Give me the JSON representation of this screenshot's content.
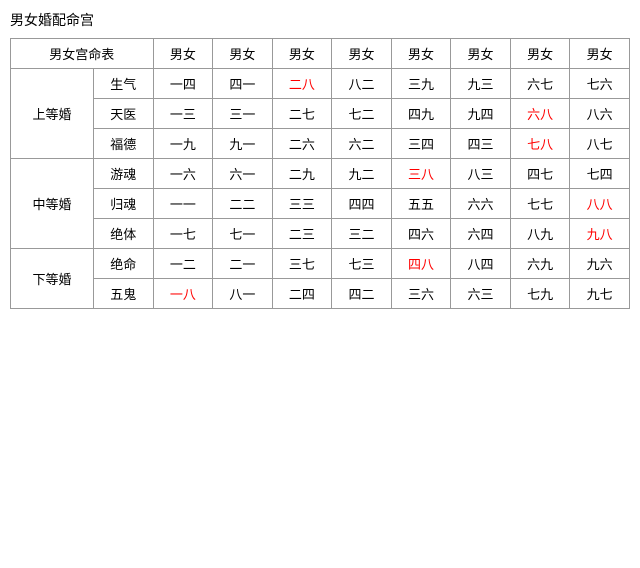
{
  "title": "男女婚配命宫",
  "table": {
    "header": {
      "col0": "男女宫命表",
      "cols": [
        "男女",
        "男女",
        "男女",
        "男女",
        "男女",
        "男女",
        "男女",
        "男女"
      ]
    },
    "groups": [
      {
        "group_label": "上等婚",
        "rows": [
          {
            "sub_label": "生气",
            "cells": [
              {
                "text": "一四",
                "red": false
              },
              {
                "text": "四一",
                "red": false
              },
              {
                "text": "二八",
                "red": true
              },
              {
                "text": "八二",
                "red": false
              },
              {
                "text": "三九",
                "red": false
              },
              {
                "text": "九三",
                "red": false
              },
              {
                "text": "六七",
                "red": false
              },
              {
                "text": "七六",
                "red": false
              }
            ]
          },
          {
            "sub_label": "天医",
            "cells": [
              {
                "text": "一三",
                "red": false
              },
              {
                "text": "三一",
                "red": false
              },
              {
                "text": "二七",
                "red": false
              },
              {
                "text": "七二",
                "red": false
              },
              {
                "text": "四九",
                "red": false
              },
              {
                "text": "九四",
                "red": false
              },
              {
                "text": "六八",
                "red": true
              },
              {
                "text": "八六",
                "red": false
              }
            ]
          },
          {
            "sub_label": "福德",
            "cells": [
              {
                "text": "一九",
                "red": false
              },
              {
                "text": "九一",
                "red": false
              },
              {
                "text": "二六",
                "red": false
              },
              {
                "text": "六二",
                "red": false
              },
              {
                "text": "三四",
                "red": false
              },
              {
                "text": "四三",
                "red": false
              },
              {
                "text": "七八",
                "red": true
              },
              {
                "text": "八七",
                "red": false
              }
            ]
          }
        ]
      },
      {
        "group_label": "中等婚",
        "rows": [
          {
            "sub_label": "游魂",
            "cells": [
              {
                "text": "一六",
                "red": false
              },
              {
                "text": "六一",
                "red": false
              },
              {
                "text": "二九",
                "red": false
              },
              {
                "text": "九二",
                "red": false
              },
              {
                "text": "三八",
                "red": true
              },
              {
                "text": "八三",
                "red": false
              },
              {
                "text": "四七",
                "red": false
              },
              {
                "text": "七四",
                "red": false
              }
            ]
          },
          {
            "sub_label": "归魂",
            "cells": [
              {
                "text": "一一",
                "red": false
              },
              {
                "text": "二二",
                "red": false
              },
              {
                "text": "三三",
                "red": false
              },
              {
                "text": "四四",
                "red": false
              },
              {
                "text": "五五",
                "red": false
              },
              {
                "text": "六六",
                "red": false
              },
              {
                "text": "七七",
                "red": false
              },
              {
                "text": "八八",
                "red": true
              }
            ]
          },
          {
            "sub_label": "绝体",
            "cells": [
              {
                "text": "一七",
                "red": false
              },
              {
                "text": "七一",
                "red": false
              },
              {
                "text": "二三",
                "red": false
              },
              {
                "text": "三二",
                "red": false
              },
              {
                "text": "四六",
                "red": false
              },
              {
                "text": "六四",
                "red": false
              },
              {
                "text": "八九",
                "red": false
              },
              {
                "text": "九八",
                "red": true
              }
            ]
          }
        ]
      },
      {
        "group_label": "下等婚",
        "rows": [
          {
            "sub_label": "绝命",
            "cells": [
              {
                "text": "一二",
                "red": false
              },
              {
                "text": "二一",
                "red": false
              },
              {
                "text": "三七",
                "red": false
              },
              {
                "text": "七三",
                "red": false
              },
              {
                "text": "四八",
                "red": true
              },
              {
                "text": "八四",
                "red": false
              },
              {
                "text": "六九",
                "red": false
              },
              {
                "text": "九六",
                "red": false
              }
            ]
          },
          {
            "sub_label": "五鬼",
            "cells": [
              {
                "text": "一八",
                "red": true
              },
              {
                "text": "八一",
                "red": false
              },
              {
                "text": "二四",
                "red": false
              },
              {
                "text": "四二",
                "red": false
              },
              {
                "text": "三六",
                "red": false
              },
              {
                "text": "六三",
                "red": false
              },
              {
                "text": "七九",
                "red": false
              },
              {
                "text": "九七",
                "red": false
              }
            ]
          }
        ]
      }
    ]
  }
}
